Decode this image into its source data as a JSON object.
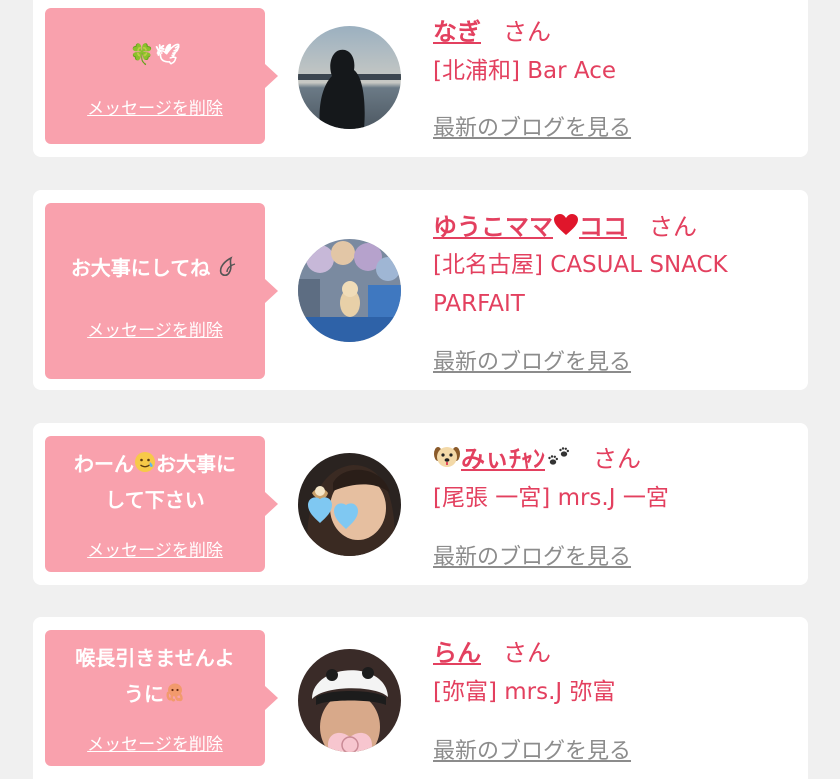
{
  "delete_label": "メッセージを削除",
  "blog_label": "最新のブログを見る",
  "san_label": "さん",
  "colors": {
    "accent": "#e3405f",
    "bubble": "#f9a1ad",
    "card": "#ffffff",
    "page": "#f0f0f0",
    "link_gray": "#8c8c8c"
  },
  "entries": [
    {
      "message": "🍀🕊",
      "name": "なぎ",
      "shop": "[北浦和] Bar Ace"
    },
    {
      "message": "お大事にしてね",
      "message_icon": "sweat-drop-icon",
      "name_a": "ゆうこママ",
      "name_icon": "red-heart-icon",
      "name_b": "ココ",
      "shop": "[北名古屋] CASUAL SNACK PARFAIT"
    },
    {
      "message_line1_a": "わーん",
      "message_icon": "smiling-tear-face-icon",
      "message_line1_b": "お大事に",
      "message_line2": "して下さい",
      "name_icon": "dog-face-icon",
      "name": "みぃﾁｬﾝ",
      "name_icon2": "paw-prints-icon",
      "shop": "[尾張 一宮] mrs.J 一宮"
    },
    {
      "message_line1": "喉長引きませんよ",
      "message_line2": "うに",
      "message_icon": "octopus-icon",
      "name": "らん",
      "shop": "[弥富] mrs.J 弥富"
    }
  ]
}
